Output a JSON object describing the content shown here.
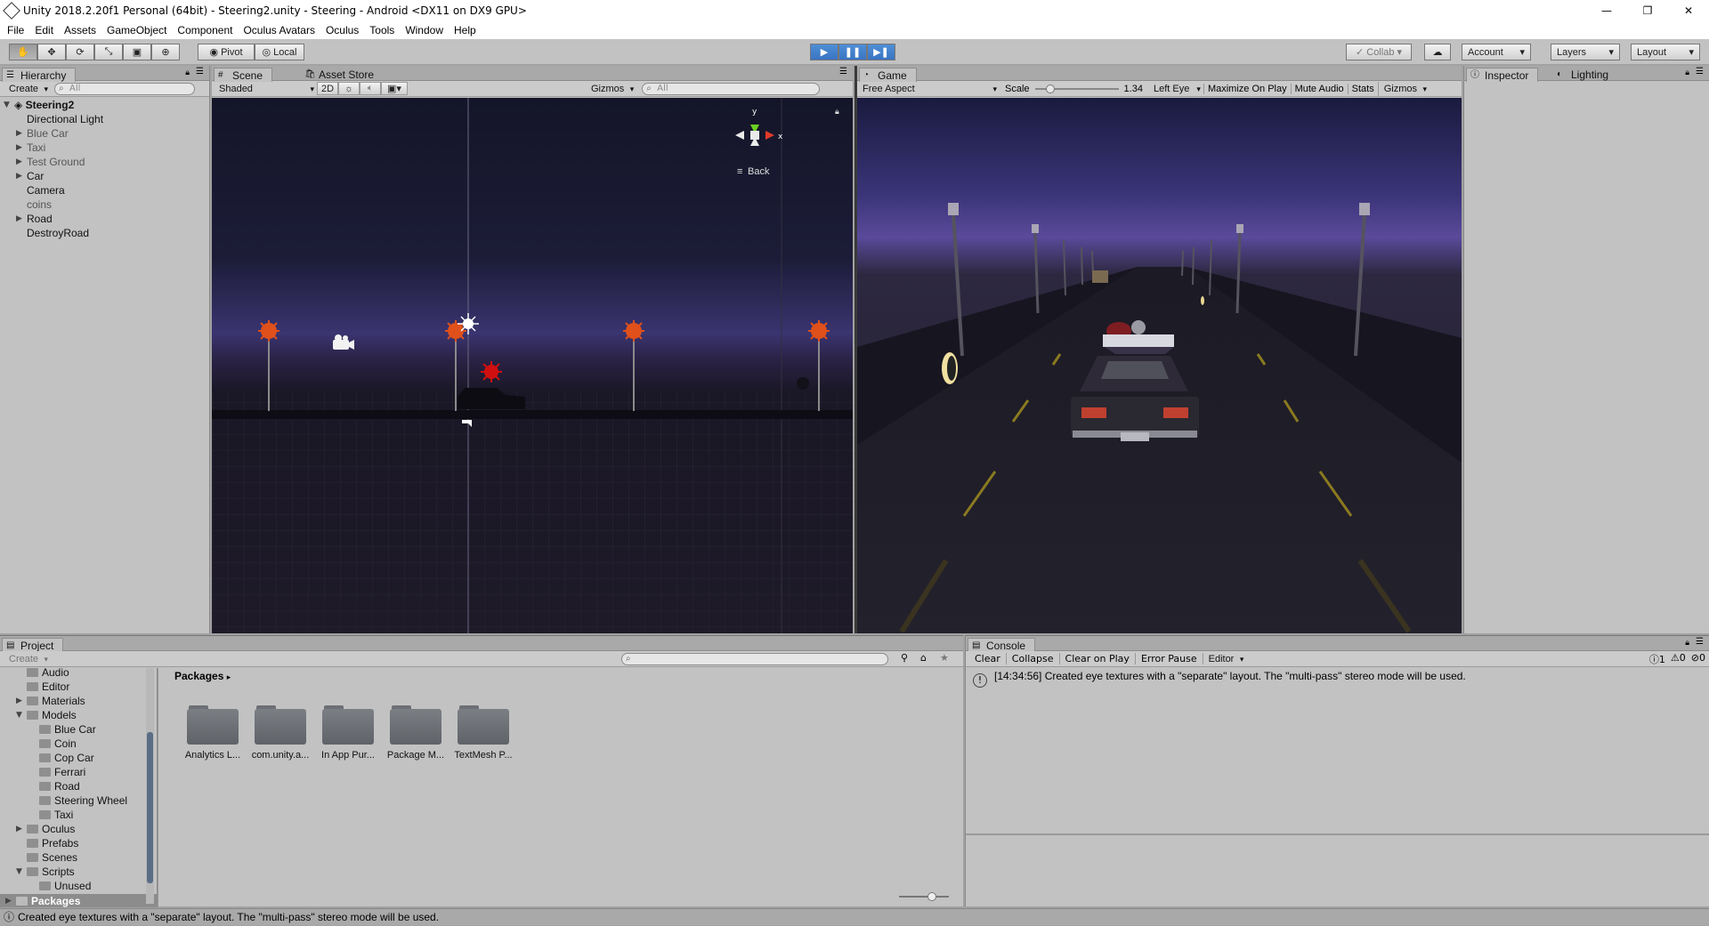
{
  "window": {
    "title": "Unity 2018.2.20f1 Personal (64bit) - Steering2.unity - Steering - Android <DX11 on DX9 GPU>",
    "minimize": "—",
    "maximize": "❐",
    "close": "✕"
  },
  "menu": [
    "File",
    "Edit",
    "Assets",
    "GameObject",
    "Component",
    "Oculus Avatars",
    "Oculus",
    "Tools",
    "Window",
    "Help"
  ],
  "toolbar": {
    "pivot": "Pivot",
    "local": "Local",
    "collab": "Collab",
    "account": "Account",
    "layers": "Layers",
    "layout": "Layout"
  },
  "hierarchy": {
    "tab": "Hierarchy",
    "create": "Create",
    "search_placeholder": "All",
    "scene": "Steering2",
    "items": [
      {
        "label": "Directional Light",
        "dim": false,
        "expandable": false
      },
      {
        "label": "Blue Car",
        "dim": true,
        "expandable": true
      },
      {
        "label": "Taxi",
        "dim": true,
        "expandable": true
      },
      {
        "label": "Test Ground",
        "dim": true,
        "expandable": true
      },
      {
        "label": "Car",
        "dim": false,
        "expandable": true
      },
      {
        "label": "Camera",
        "dim": false,
        "expandable": false
      },
      {
        "label": "coins",
        "dim": true,
        "expandable": false
      },
      {
        "label": "Road",
        "dim": false,
        "expandable": true
      },
      {
        "label": "DestroyRoad",
        "dim": false,
        "expandable": false
      }
    ]
  },
  "scene": {
    "tab": "Scene",
    "asset_store_tab": "Asset Store",
    "shading": "Shaded",
    "mode2d": "2D",
    "gizmos": "Gizmos",
    "search_placeholder": "All",
    "gizmo_y": "y",
    "gizmo_x": "x",
    "view_label": "Back"
  },
  "game": {
    "tab": "Game",
    "aspect": "Free Aspect",
    "scale_label": "Scale",
    "scale_value": "1.34",
    "eye": "Left Eye",
    "maximize": "Maximize On Play",
    "mute": "Mute Audio",
    "stats": "Stats",
    "gizmos": "Gizmos"
  },
  "inspector": {
    "tab": "Inspector",
    "lighting_tab": "Lighting"
  },
  "project": {
    "tab": "Project",
    "create": "Create",
    "breadcrumb": "Packages",
    "tree": [
      {
        "label": "Audio",
        "level": 1,
        "arrow": ""
      },
      {
        "label": "Editor",
        "level": 1,
        "arrow": ""
      },
      {
        "label": "Materials",
        "level": 1,
        "arrow": "▶"
      },
      {
        "label": "Models",
        "level": 1,
        "arrow": "▼"
      },
      {
        "label": "Blue Car",
        "level": 2,
        "arrow": ""
      },
      {
        "label": "Coin",
        "level": 2,
        "arrow": ""
      },
      {
        "label": "Cop Car",
        "level": 2,
        "arrow": ""
      },
      {
        "label": "Ferrari",
        "level": 2,
        "arrow": ""
      },
      {
        "label": "Road",
        "level": 2,
        "arrow": ""
      },
      {
        "label": "Steering Wheel",
        "level": 2,
        "arrow": ""
      },
      {
        "label": "Taxi",
        "level": 2,
        "arrow": ""
      },
      {
        "label": "Oculus",
        "level": 1,
        "arrow": "▶"
      },
      {
        "label": "Prefabs",
        "level": 1,
        "arrow": ""
      },
      {
        "label": "Scenes",
        "level": 1,
        "arrow": ""
      },
      {
        "label": "Scripts",
        "level": 1,
        "arrow": "▼"
      },
      {
        "label": "Unused",
        "level": 2,
        "arrow": ""
      }
    ],
    "packages_root": "Packages",
    "folders": [
      "Analytics L...",
      "com.unity.a...",
      "In App Pur...",
      "Package M...",
      "TextMesh P..."
    ]
  },
  "console": {
    "tab": "Console",
    "clear": "Clear",
    "collapse": "Collapse",
    "clear_on_play": "Clear on Play",
    "error_pause": "Error Pause",
    "editor": "Editor",
    "counts": {
      "info": "1",
      "warn": "0",
      "error": "0"
    },
    "messages": [
      "[14:34:56] Created eye textures with a \"separate\" layout.  The \"multi-pass\" stereo mode will be used."
    ]
  },
  "status": "Created eye textures with a \"separate\" layout.  The \"multi-pass\" stereo mode will be used.",
  "colors": {
    "play_blue": "#3a74c2",
    "scene_sky_top": "#15162a",
    "scene_horizon": "#3d3570",
    "lamp_orange": "#e0501a"
  }
}
